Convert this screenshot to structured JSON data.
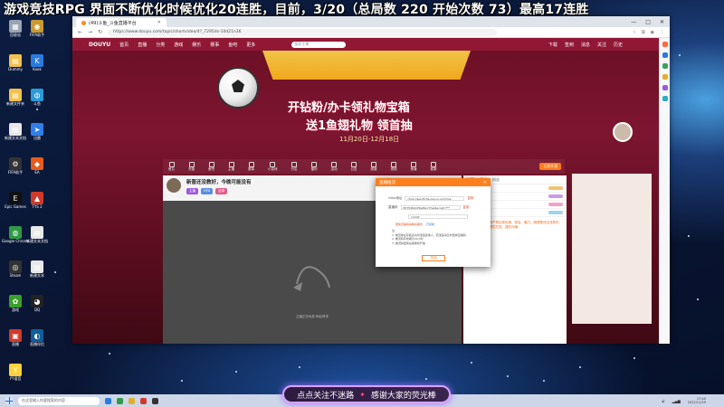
{
  "overlay": {
    "title": "游戏竞技RPG  界面不断优化时候优化20连胜，目前，3/20（总局数 220  开始次数 73）最高17连胜"
  },
  "desktop_icons": [
    {
      "label": "回收站",
      "color": "#9aa4b2",
      "glyph": "▦"
    },
    {
      "label": "FIFA助手",
      "color": "#c89a30",
      "glyph": "◉"
    },
    {
      "label": "Dummy",
      "color": "#f2c14e",
      "glyph": "▤"
    },
    {
      "label": "Kook",
      "color": "#2a7be0",
      "glyph": "K"
    },
    {
      "label": "新建文件夹",
      "color": "#f2c14e",
      "glyph": "▤"
    },
    {
      "label": "斗鱼",
      "color": "#2c9ad6",
      "glyph": "ф"
    },
    {
      "label": "新建文本文档",
      "color": "#e8e8e8",
      "glyph": "▤"
    },
    {
      "label": "迅雷",
      "color": "#2f7fe8",
      "glyph": "➤"
    },
    {
      "label": "FIFA助手",
      "color": "#333",
      "glyph": "⚙"
    },
    {
      "label": "EA",
      "color": "#e85a1a",
      "glyph": "◆"
    },
    {
      "label": "Epic Games",
      "color": "#111",
      "glyph": "E"
    },
    {
      "label": "TYS 2",
      "color": "#d03a2a",
      "glyph": "▲"
    },
    {
      "label": "Google Chrome",
      "color": "#2f9a47",
      "glyph": "◍"
    },
    {
      "label": "新建文本文档",
      "color": "#e8e8e8",
      "glyph": "▤"
    },
    {
      "label": "Steam",
      "color": "#333",
      "glyph": "◎"
    },
    {
      "label": "新建文本",
      "color": "#e8e8e8",
      "glyph": "▤"
    },
    {
      "label": "游戏",
      "color": "#3aa02a",
      "glyph": "✿"
    },
    {
      "label": "QQ",
      "color": "#222",
      "glyph": "◕"
    },
    {
      "label": "直播",
      "color": "#d03a2a",
      "glyph": "▣"
    },
    {
      "label": "直播伴侣",
      "color": "#0f5f9a",
      "glyph": "◐"
    },
    {
      "label": "YY语音",
      "color": "#ffd23c",
      "glyph": "Y"
    }
  ],
  "browser": {
    "tab_title": "(49)斗鱼_斗鱼直播平台",
    "url": "https://www.douyu.com/topic/shortvideo/4?_7295ds-10d21n36",
    "win_controls": [
      "—",
      "□",
      "✕"
    ]
  },
  "site": {
    "logo": "DOUYU",
    "nav": [
      "首页",
      "直播",
      "分类",
      "游戏",
      "娱乐",
      "赛事",
      "鱼吧",
      "更多"
    ],
    "search_placeholder": "搜索主播",
    "nav_right": [
      "下载",
      "签到",
      "消息",
      "关注",
      "历史"
    ],
    "banner_line1": "开钻粉/办卡领礼物宝箱",
    "banner_line2": "送1鱼翅礼物  领首抽",
    "banner_date": "11月20日-12月18日",
    "categories": [
      "鱼丸",
      "充值",
      "鱼吧",
      "主播",
      "赛事",
      "小游戏",
      "分区",
      "福利",
      "活动",
      "公告",
      "频道",
      "视频",
      "鱼塘",
      "客服"
    ],
    "category_btn": "立即开通",
    "room_title": "新晋还没教好，今晚可能没有",
    "room_tags": [
      {
        "text": "主播",
        "color": "#9b59d9"
      },
      {
        "text": "FIFA",
        "color": "#5a8de0"
      },
      {
        "text": "足球",
        "color": "#e05a8d"
      }
    ],
    "room_follow": "关注",
    "player_hint": "主播正在休息  稍后再来",
    "chat_tabs": [
      "弹幕",
      "贡献",
      "粉丝"
    ],
    "chat_rows": [
      {
        "label": "前三名",
        "color": "#f4c26b"
      },
      {
        "label": "超级",
        "color": "#c99be8"
      },
      {
        "label": "钻粉",
        "color": "#f3a1c7"
      },
      {
        "label": "守护",
        "color": "#9fd3f0"
      }
    ],
    "chat_text": "系统提示：直播间严禁出现色情、低俗、暴力、赌博等违法违规内容，文明观看，理性打赏，谨防诈骗"
  },
  "modal": {
    "title": "直播推流",
    "server_label": "rtmp地址",
    "server_value": "rtmp://sendtc3a.douyu.com/live",
    "key_label": "直播码",
    "key_value": "8375360rrHbqBqyT?wsSecret=***",
    "copy_label": "复制",
    "select_value": "1920P",
    "link_1": "更新直播码请联系超管",
    "link_2": "已复制",
    "notes": "注：\n1. 推流地址获取后请勿泄露给他人，若泄露请及时更换直播码\n2. 推流码有效期为24小时\n3. 推流码更换后需重新开播",
    "ok_label": "关闭"
  },
  "bottom_banner": {
    "left": "点点关注不迷路",
    "right": "感谢大家的荧光棒"
  },
  "taskbar": {
    "search_placeholder": "在这里输入你要搜索的内容",
    "clock_time": "17:40",
    "clock_date": "2022/11/29"
  },
  "colors": {
    "accent": "#ff7f1c",
    "site_bg": "#7e1530"
  }
}
